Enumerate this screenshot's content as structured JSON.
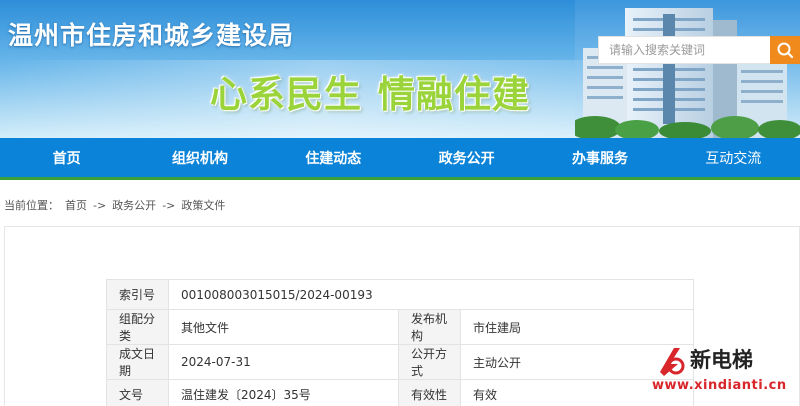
{
  "header": {
    "site_title": "温州市住房和城乡建设局",
    "slogan_left": "心系民生",
    "slogan_right": "情融住建",
    "search_placeholder": "请输入搜索关键词",
    "colors": {
      "title": "#ffffff",
      "slogan": "#9ad43a",
      "search_button": "#f08a1c"
    }
  },
  "nav": {
    "items": [
      {
        "label": "首页"
      },
      {
        "label": "组织机构"
      },
      {
        "label": "住建动态"
      },
      {
        "label": "政务公开"
      },
      {
        "label": "办事服务"
      },
      {
        "label": "互动交流"
      }
    ],
    "colors": {
      "background": "#0b83d8",
      "underline": "#3aa03a"
    }
  },
  "breadcrumb": {
    "prefix": "当前位置：",
    "items": [
      "首页",
      "政务公开",
      "政策文件"
    ],
    "separator": "->"
  },
  "info": {
    "index_label": "索引号",
    "index_value": "001008003015015/2024-00193",
    "category_label": "组配分类",
    "category_value": "其他文件",
    "publisher_label": "发布机构",
    "publisher_value": "市住建局",
    "date_label": "成文日期",
    "date_value": "2024-07-31",
    "disclosure_label": "公开方式",
    "disclosure_value": "主动公开",
    "doc_no_label": "文号",
    "doc_no_value": "温住建发〔2024〕35号",
    "validity_label": "有效性",
    "validity_value": "有效"
  },
  "watermark": {
    "title": "新电梯",
    "url": "www.xindianti.cn",
    "icon": "xindianti-logo-icon"
  }
}
